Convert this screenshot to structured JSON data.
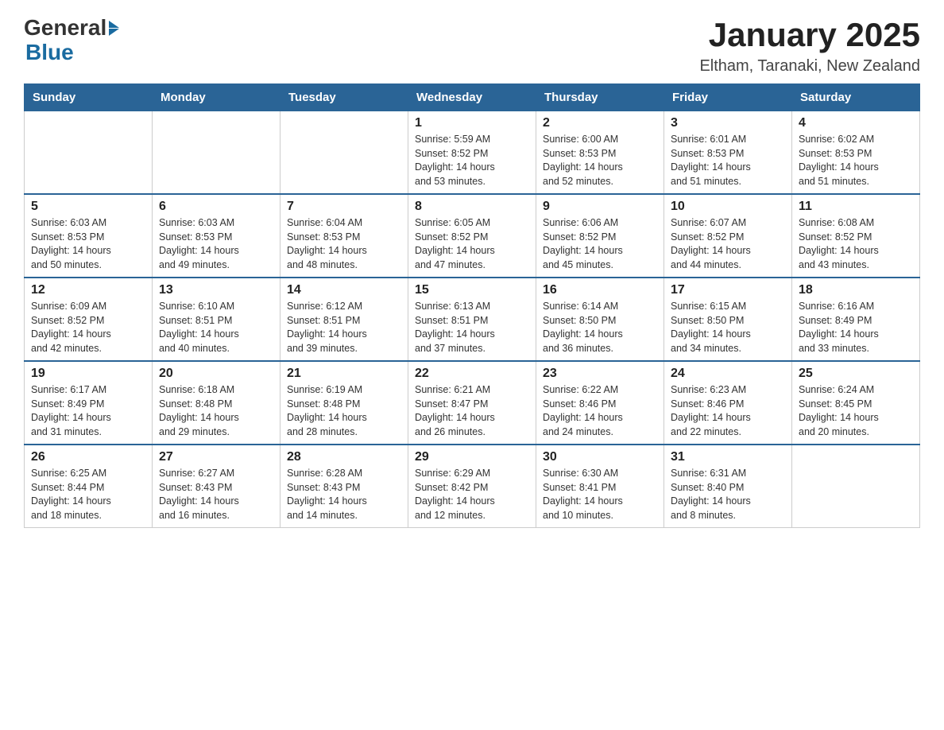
{
  "header": {
    "logo_general": "General",
    "logo_blue": "Blue",
    "title": "January 2025",
    "subtitle": "Eltham, Taranaki, New Zealand"
  },
  "calendar": {
    "days_of_week": [
      "Sunday",
      "Monday",
      "Tuesday",
      "Wednesday",
      "Thursday",
      "Friday",
      "Saturday"
    ],
    "weeks": [
      [
        {
          "day": "",
          "info": ""
        },
        {
          "day": "",
          "info": ""
        },
        {
          "day": "",
          "info": ""
        },
        {
          "day": "1",
          "info": "Sunrise: 5:59 AM\nSunset: 8:52 PM\nDaylight: 14 hours\nand 53 minutes."
        },
        {
          "day": "2",
          "info": "Sunrise: 6:00 AM\nSunset: 8:53 PM\nDaylight: 14 hours\nand 52 minutes."
        },
        {
          "day": "3",
          "info": "Sunrise: 6:01 AM\nSunset: 8:53 PM\nDaylight: 14 hours\nand 51 minutes."
        },
        {
          "day": "4",
          "info": "Sunrise: 6:02 AM\nSunset: 8:53 PM\nDaylight: 14 hours\nand 51 minutes."
        }
      ],
      [
        {
          "day": "5",
          "info": "Sunrise: 6:03 AM\nSunset: 8:53 PM\nDaylight: 14 hours\nand 50 minutes."
        },
        {
          "day": "6",
          "info": "Sunrise: 6:03 AM\nSunset: 8:53 PM\nDaylight: 14 hours\nand 49 minutes."
        },
        {
          "day": "7",
          "info": "Sunrise: 6:04 AM\nSunset: 8:53 PM\nDaylight: 14 hours\nand 48 minutes."
        },
        {
          "day": "8",
          "info": "Sunrise: 6:05 AM\nSunset: 8:52 PM\nDaylight: 14 hours\nand 47 minutes."
        },
        {
          "day": "9",
          "info": "Sunrise: 6:06 AM\nSunset: 8:52 PM\nDaylight: 14 hours\nand 45 minutes."
        },
        {
          "day": "10",
          "info": "Sunrise: 6:07 AM\nSunset: 8:52 PM\nDaylight: 14 hours\nand 44 minutes."
        },
        {
          "day": "11",
          "info": "Sunrise: 6:08 AM\nSunset: 8:52 PM\nDaylight: 14 hours\nand 43 minutes."
        }
      ],
      [
        {
          "day": "12",
          "info": "Sunrise: 6:09 AM\nSunset: 8:52 PM\nDaylight: 14 hours\nand 42 minutes."
        },
        {
          "day": "13",
          "info": "Sunrise: 6:10 AM\nSunset: 8:51 PM\nDaylight: 14 hours\nand 40 minutes."
        },
        {
          "day": "14",
          "info": "Sunrise: 6:12 AM\nSunset: 8:51 PM\nDaylight: 14 hours\nand 39 minutes."
        },
        {
          "day": "15",
          "info": "Sunrise: 6:13 AM\nSunset: 8:51 PM\nDaylight: 14 hours\nand 37 minutes."
        },
        {
          "day": "16",
          "info": "Sunrise: 6:14 AM\nSunset: 8:50 PM\nDaylight: 14 hours\nand 36 minutes."
        },
        {
          "day": "17",
          "info": "Sunrise: 6:15 AM\nSunset: 8:50 PM\nDaylight: 14 hours\nand 34 minutes."
        },
        {
          "day": "18",
          "info": "Sunrise: 6:16 AM\nSunset: 8:49 PM\nDaylight: 14 hours\nand 33 minutes."
        }
      ],
      [
        {
          "day": "19",
          "info": "Sunrise: 6:17 AM\nSunset: 8:49 PM\nDaylight: 14 hours\nand 31 minutes."
        },
        {
          "day": "20",
          "info": "Sunrise: 6:18 AM\nSunset: 8:48 PM\nDaylight: 14 hours\nand 29 minutes."
        },
        {
          "day": "21",
          "info": "Sunrise: 6:19 AM\nSunset: 8:48 PM\nDaylight: 14 hours\nand 28 minutes."
        },
        {
          "day": "22",
          "info": "Sunrise: 6:21 AM\nSunset: 8:47 PM\nDaylight: 14 hours\nand 26 minutes."
        },
        {
          "day": "23",
          "info": "Sunrise: 6:22 AM\nSunset: 8:46 PM\nDaylight: 14 hours\nand 24 minutes."
        },
        {
          "day": "24",
          "info": "Sunrise: 6:23 AM\nSunset: 8:46 PM\nDaylight: 14 hours\nand 22 minutes."
        },
        {
          "day": "25",
          "info": "Sunrise: 6:24 AM\nSunset: 8:45 PM\nDaylight: 14 hours\nand 20 minutes."
        }
      ],
      [
        {
          "day": "26",
          "info": "Sunrise: 6:25 AM\nSunset: 8:44 PM\nDaylight: 14 hours\nand 18 minutes."
        },
        {
          "day": "27",
          "info": "Sunrise: 6:27 AM\nSunset: 8:43 PM\nDaylight: 14 hours\nand 16 minutes."
        },
        {
          "day": "28",
          "info": "Sunrise: 6:28 AM\nSunset: 8:43 PM\nDaylight: 14 hours\nand 14 minutes."
        },
        {
          "day": "29",
          "info": "Sunrise: 6:29 AM\nSunset: 8:42 PM\nDaylight: 14 hours\nand 12 minutes."
        },
        {
          "day": "30",
          "info": "Sunrise: 6:30 AM\nSunset: 8:41 PM\nDaylight: 14 hours\nand 10 minutes."
        },
        {
          "day": "31",
          "info": "Sunrise: 6:31 AM\nSunset: 8:40 PM\nDaylight: 14 hours\nand 8 minutes."
        },
        {
          "day": "",
          "info": ""
        }
      ]
    ]
  }
}
